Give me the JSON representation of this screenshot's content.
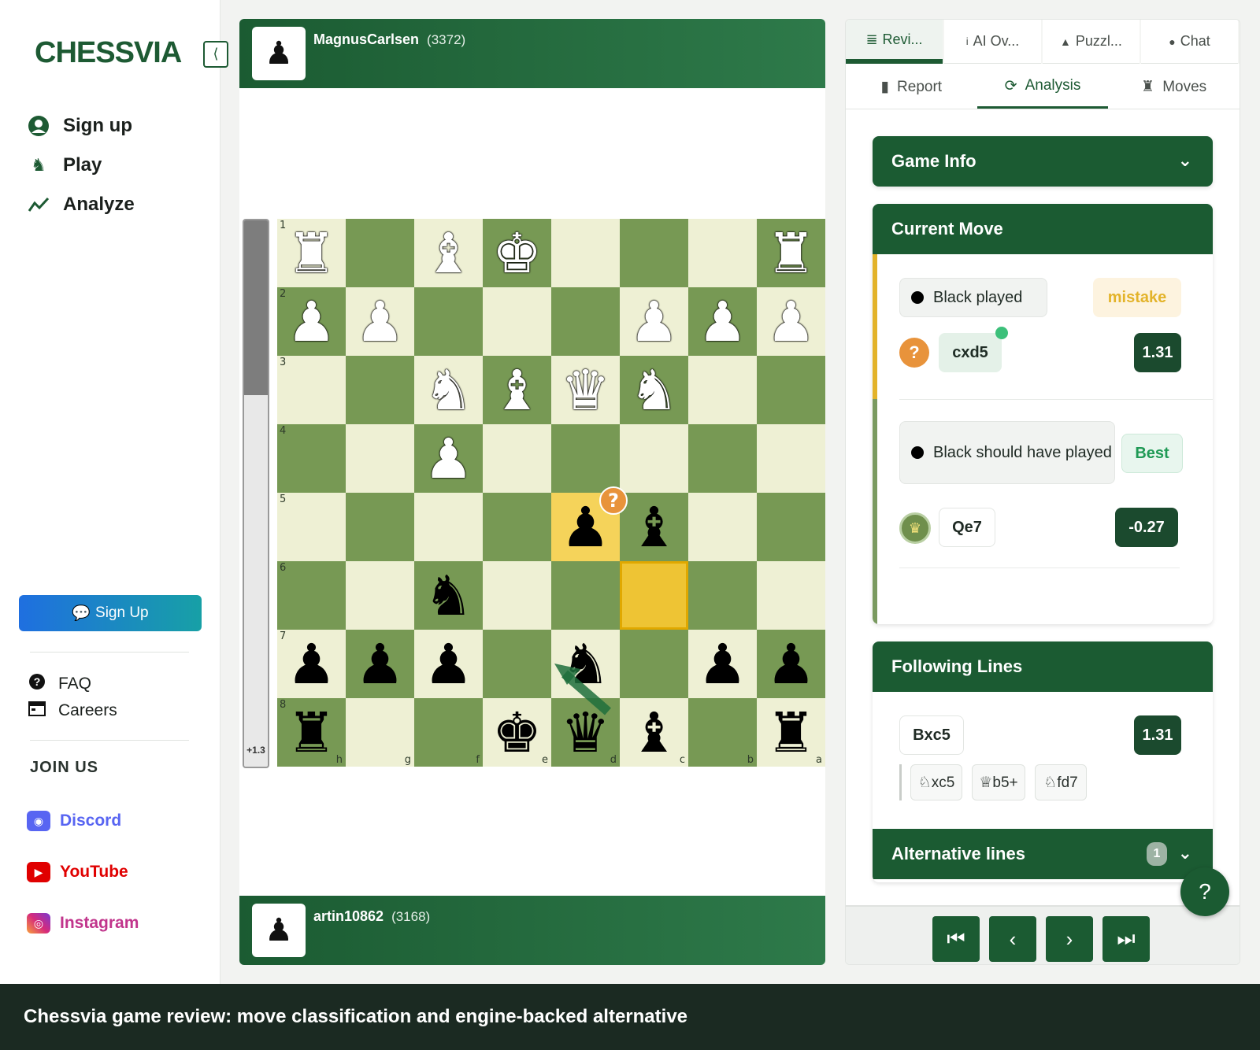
{
  "sidebar": {
    "brand": "CHESSVIA",
    "nav": [
      {
        "label": "Sign up",
        "icon": "user-circle-icon"
      },
      {
        "label": "Play",
        "icon": "knight-icon"
      },
      {
        "label": "Analyze",
        "icon": "chart-line-icon"
      }
    ],
    "cta_label": "Sign Up",
    "links": [
      {
        "label": "FAQ",
        "icon": "question-circle-icon"
      },
      {
        "label": "Careers",
        "icon": "calendar-icon"
      }
    ],
    "join_label": "JOIN US",
    "social": [
      {
        "label": "Discord",
        "icon": "discord-icon",
        "color": "#5865F2"
      },
      {
        "label": "YouTube",
        "icon": "youtube-icon",
        "color": "#E00000"
      },
      {
        "label": "Instagram",
        "icon": "instagram-icon",
        "color": "#C1358C"
      }
    ]
  },
  "players": {
    "top": {
      "name": "MagnusCarlsen",
      "rating": "(3372)"
    },
    "bottom": {
      "name": "artin10862",
      "rating": "(3168)"
    }
  },
  "eval_bar": {
    "label": "+1.3"
  },
  "board": {
    "ranks_labels": [
      "1",
      "2",
      "3",
      "4",
      "5",
      "6",
      "7",
      "8"
    ],
    "files_labels": [
      "h",
      "g",
      "f",
      "e",
      "d",
      "c",
      "b",
      "a"
    ],
    "rows": [
      [
        "wR",
        "",
        "wB",
        "wK",
        "",
        "",
        "",
        "wR"
      ],
      [
        "wP",
        "wP",
        "",
        "",
        "",
        "wP",
        "wP",
        "wP"
      ],
      [
        "",
        "",
        "wN",
        "wB",
        "wQ",
        "wN",
        "",
        ""
      ],
      [
        "",
        "",
        "wP",
        "",
        "",
        "",
        "",
        ""
      ],
      [
        "",
        "",
        "",
        "",
        "bP",
        "bB",
        "",
        ""
      ],
      [
        "",
        "",
        "bN",
        "",
        "",
        "",
        "",
        ""
      ],
      [
        "bP",
        "bP",
        "bP",
        "",
        "bN",
        "",
        "bP",
        "bP"
      ],
      [
        "bR",
        "",
        "",
        "bK",
        "bQ",
        "bB",
        "",
        "bR"
      ]
    ],
    "highlight_from": "d5",
    "highlight_to": "c6"
  },
  "tabs": {
    "top": [
      {
        "label": "Revi...",
        "icon": "list-icon"
      },
      {
        "label": "AI Ov...",
        "icon": "info-icon"
      },
      {
        "label": "Puzzl...",
        "icon": "warning-triangle-icon"
      },
      {
        "label": "Chat",
        "icon": "chat-bubble-icon"
      }
    ],
    "sub": [
      {
        "label": "Report",
        "icon": "document-icon"
      },
      {
        "label": "Analysis",
        "icon": "refresh-search-icon"
      },
      {
        "label": "Moves",
        "icon": "rook-icon"
      }
    ]
  },
  "game_info": {
    "title": "Game Info"
  },
  "current_move": {
    "title": "Current Move",
    "played_label": "Black played",
    "classification": "mistake",
    "played_move": "cxd5",
    "played_score": "1.31",
    "should_label": "Black should have played",
    "best_label": "Best",
    "best_move": "Qe7",
    "best_score": "-0.27"
  },
  "following": {
    "title": "Following Lines",
    "move": "Bxc5",
    "score": "1.31",
    "continuation": [
      "♘xc5",
      "♕b5+",
      "♘fd7"
    ]
  },
  "alternative": {
    "title": "Alternative lines",
    "count": "1"
  },
  "caption": "Chessvia game review: move classification and engine-backed alternative",
  "colors": {
    "brand_green": "#1b5b32",
    "mistake": "#e3b32a",
    "best": "#1f9a55"
  }
}
